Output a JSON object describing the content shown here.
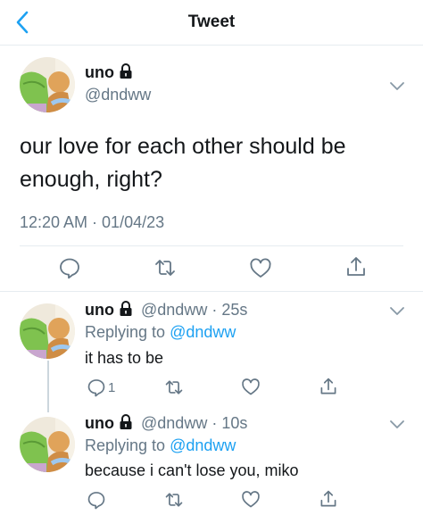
{
  "header": {
    "title": "Tweet"
  },
  "main_tweet": {
    "name": "uno",
    "handle": "@dndww",
    "text_line1": "our love for each other should be",
    "text_line2": "enough, right?",
    "timestamp": "12:20 AM · 01/04/23"
  },
  "replies": [
    {
      "name": "uno",
      "handle": "@dndww",
      "time": "· 25s",
      "replying_prefix": "Replying to",
      "replying_to": "@dndww",
      "text": "it has to be",
      "reply_count": "1"
    },
    {
      "name": "uno",
      "handle": "@dndww",
      "time": "· 10s",
      "replying_prefix": "Replying to",
      "replying_to": "@dndww",
      "text": "because i can't lose you, miko"
    }
  ],
  "colors": {
    "accent": "#1da1f2",
    "muted": "#657786",
    "divider": "#e6ecf0"
  },
  "icons": [
    "back-arrow-icon",
    "lock-icon",
    "chevron-down-icon",
    "reply-icon",
    "retweet-icon",
    "like-icon",
    "share-icon"
  ]
}
